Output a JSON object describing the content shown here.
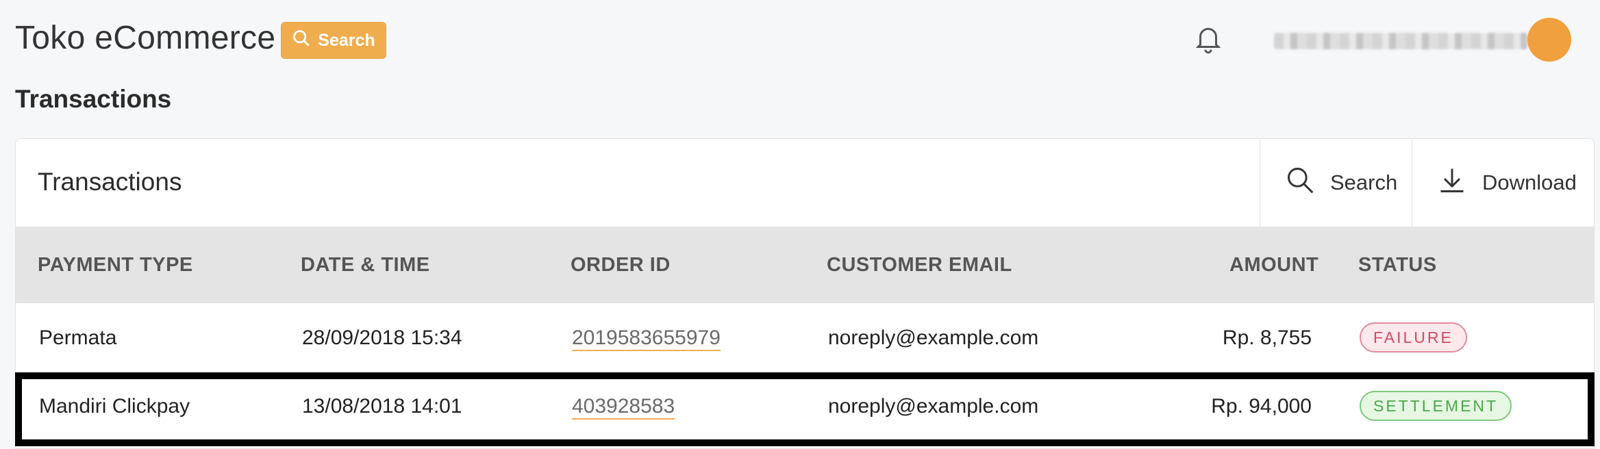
{
  "app": {
    "title": "Toko eCommerce",
    "search_label": "Search"
  },
  "page": {
    "heading": "Transactions"
  },
  "card": {
    "title": "Transactions",
    "search_label": "Search",
    "download_label": "Download"
  },
  "table": {
    "headers": [
      "PAYMENT TYPE",
      "DATE & TIME",
      "ORDER ID",
      "CUSTOMER EMAIL",
      "AMOUNT",
      "STATUS"
    ],
    "rows": [
      {
        "payment_type": "Permata",
        "datetime": "28/09/2018 15:34",
        "order_id": "2019583655979",
        "email": "noreply@example.com",
        "amount": "Rp. 8,755",
        "status": "FAILURE"
      },
      {
        "payment_type": "Mandiri Clickpay",
        "datetime": "13/08/2018 14:01",
        "order_id": "403928583",
        "email": "noreply@example.com",
        "amount": "Rp. 94,000",
        "status": "SETTLEMENT"
      }
    ]
  },
  "colors": {
    "accent": "#f0ad4e",
    "avatar": "#f0a03c",
    "failure": "#d24a63",
    "settlement": "#4aa84a"
  },
  "icons": [
    "search-icon",
    "bell-icon",
    "download-icon"
  ]
}
